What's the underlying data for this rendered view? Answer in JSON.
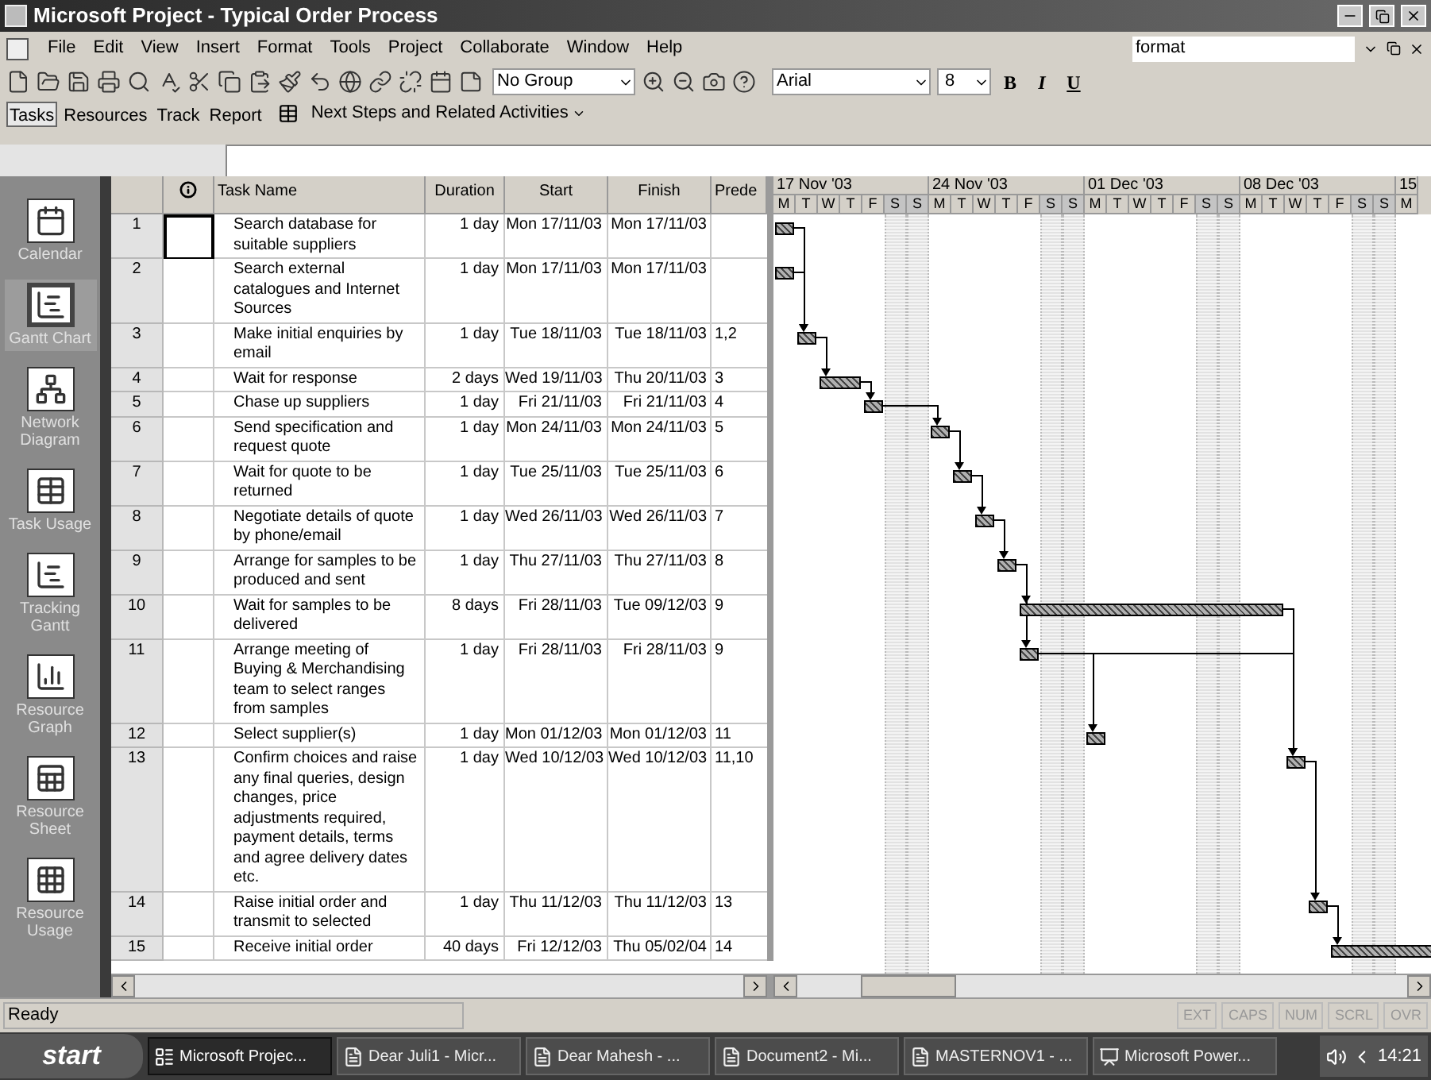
{
  "window": {
    "title": "Microsoft Project - Typical Order Process"
  },
  "menu": [
    "File",
    "Edit",
    "View",
    "Insert",
    "Format",
    "Tools",
    "Project",
    "Collaborate",
    "Window",
    "Help"
  ],
  "help_search": {
    "value": "format"
  },
  "toolbar": {
    "group": "No Group",
    "font": "Arial",
    "size": "8",
    "format_buttons": [
      "B",
      "I",
      "U"
    ]
  },
  "guide_toolbar": {
    "items": [
      {
        "label": "Tasks",
        "selected": true
      },
      {
        "label": "Resources",
        "selected": false
      },
      {
        "label": "Track",
        "selected": false
      },
      {
        "label": "Report",
        "selected": false
      }
    ],
    "next_steps": "Next Steps and Related Activities"
  },
  "view_bar": [
    {
      "label": "Calendar",
      "selected": false
    },
    {
      "label": "Gantt Chart",
      "selected": true
    },
    {
      "label": "Network Diagram",
      "selected": false
    },
    {
      "label": "Task Usage",
      "selected": false
    },
    {
      "label": "Tracking Gantt",
      "selected": false
    },
    {
      "label": "Resource Graph",
      "selected": false
    },
    {
      "label": "Resource Sheet",
      "selected": false
    },
    {
      "label": "Resource Usage",
      "selected": false
    }
  ],
  "table": {
    "columns": [
      "Task Name",
      "Duration",
      "Start",
      "Finish",
      "Prede"
    ],
    "rows": [
      {
        "id": "1",
        "name": "Search database for suitable suppliers",
        "duration": "1 day",
        "start": "Mon 17/11/03",
        "finish": "Mon 17/11/03",
        "selected": true
      },
      {
        "id": "2",
        "name": "Search external catalogues and Internet Sources",
        "duration": "1 day",
        "start": "Mon 17/11/03",
        "finish": "Mon 17/11/03",
        "selected": false
      },
      {
        "id": "3",
        "name": "Make initial enquiries by email",
        "duration": "1 day",
        "start": "Tue 18/11/03",
        "finish": "Tue 18/11/03",
        "predecessors": "1,2",
        "selected": false
      },
      {
        "id": "4",
        "name": "Wait for response",
        "duration": "2 days",
        "start": "Wed 19/11/03",
        "finish": "Thu 20/11/03",
        "predecessors": "3",
        "selected": false
      },
      {
        "id": "5",
        "name": "Chase up suppliers",
        "duration": "1 day",
        "start": "Fri 21/11/03",
        "finish": "Fri 21/11/03",
        "predecessors": "4",
        "selected": false
      },
      {
        "id": "6",
        "name": "Send specification and request quote",
        "duration": "1 day",
        "start": "Mon 24/11/03",
        "finish": "Mon 24/11/03",
        "predecessors": "5",
        "selected": false
      },
      {
        "id": "7",
        "name": "Wait for quote to be returned",
        "duration": "1 day",
        "start": "Tue 25/11/03",
        "finish": "Tue 25/11/03",
        "predecessors": "6",
        "selected": false
      },
      {
        "id": "8",
        "name": "Negotiate details of quote by phone/email",
        "duration": "1 day",
        "start": "Wed 26/11/03",
        "finish": "Wed 26/11/03",
        "predecessors": "7",
        "selected": false
      },
      {
        "id": "9",
        "name": "Arrange for samples to be produced and sent",
        "duration": "1 day",
        "start": "Thu 27/11/03",
        "finish": "Thu 27/11/03",
        "predecessors": "8",
        "selected": false
      },
      {
        "id": "10",
        "name": "Wait for samples to be delivered",
        "duration": "8 days",
        "start": "Fri 28/11/03",
        "finish": "Tue 09/12/03",
        "predecessors": "9",
        "selected": false
      },
      {
        "id": "11",
        "name": "Arrange meeting of Buying & Merchandising team to select ranges from samples",
        "duration": "1 day",
        "start": "Fri 28/11/03",
        "finish": "Fri 28/11/03",
        "predecessors": "9",
        "selected": false
      },
      {
        "id": "12",
        "name": "Select supplier(s)",
        "duration": "1 day",
        "start": "Mon 01/12/03",
        "finish": "Mon 01/12/03",
        "predecessors": "11",
        "selected": false
      },
      {
        "id": "13",
        "name": "Confirm choices and raise any final queries, design changes, price adjustments required, payment details, terms and agree delivery dates etc.",
        "duration": "1 day",
        "start": "Wed 10/12/03",
        "finish": "Wed 10/12/03",
        "predecessors": "11,10",
        "selected": false
      },
      {
        "id": "14",
        "name": "Raise initial order and transmit to selected",
        "duration": "1 day",
        "start": "Thu 11/12/03",
        "finish": "Thu 11/12/03",
        "predecessors": "13",
        "selected": false
      },
      {
        "id": "15",
        "name": "Receive initial order",
        "duration": "40 days",
        "start": "Fri 12/12/03",
        "finish": "Thu 05/02/04",
        "predecessors": "14",
        "selected": false
      }
    ]
  },
  "timeline": {
    "weeks": [
      {
        "label": "17 Nov '03",
        "days": [
          {
            "d": "M",
            "nonworking": false
          },
          {
            "d": "T",
            "nonworking": false
          },
          {
            "d": "W",
            "nonworking": false
          },
          {
            "d": "T",
            "nonworking": false
          },
          {
            "d": "F",
            "nonworking": false
          },
          {
            "d": "S",
            "nonworking": true
          },
          {
            "d": "S",
            "nonworking": true
          }
        ]
      },
      {
        "label": "24 Nov '03",
        "days": [
          {
            "d": "M",
            "nonworking": false
          },
          {
            "d": "T",
            "nonworking": false
          },
          {
            "d": "W",
            "nonworking": false
          },
          {
            "d": "T",
            "nonworking": false
          },
          {
            "d": "F",
            "nonworking": false
          },
          {
            "d": "S",
            "nonworking": true
          },
          {
            "d": "S",
            "nonworking": true
          }
        ]
      },
      {
        "label": "01 Dec '03",
        "days": [
          {
            "d": "M",
            "nonworking": false
          },
          {
            "d": "T",
            "nonworking": false
          },
          {
            "d": "W",
            "nonworking": false
          },
          {
            "d": "T",
            "nonworking": false
          },
          {
            "d": "F",
            "nonworking": false
          },
          {
            "d": "S",
            "nonworking": true
          },
          {
            "d": "S",
            "nonworking": true
          }
        ]
      },
      {
        "label": "08 Dec '03",
        "days": [
          {
            "d": "M",
            "nonworking": false
          },
          {
            "d": "T",
            "nonworking": false
          },
          {
            "d": "W",
            "nonworking": false
          },
          {
            "d": "T",
            "nonworking": false
          },
          {
            "d": "F",
            "nonworking": false
          },
          {
            "d": "S",
            "nonworking": true
          },
          {
            "d": "S",
            "nonworking": true
          }
        ]
      },
      {
        "label": "15",
        "days": [
          {
            "d": "M",
            "nonworking": false
          }
        ]
      }
    ]
  },
  "status_bar": {
    "text": "Ready",
    "indicators": [
      {
        "label": "EXT",
        "active": false
      },
      {
        "label": "CAPS",
        "active": false
      },
      {
        "label": "NUM",
        "active": false
      },
      {
        "label": "SCRL",
        "active": false
      },
      {
        "label": "OVR",
        "active": false
      }
    ]
  },
  "taskbar": {
    "start": "start",
    "buttons": [
      {
        "label": "Microsoft Projec...",
        "selected": true
      },
      {
        "label": "Dear Juli1 - Micr...",
        "selected": false
      },
      {
        "label": "Dear Mahesh - ...",
        "selected": false
      },
      {
        "label": "Document2 - Mi...",
        "selected": false
      },
      {
        "label": "MASTERNOV1 - ...",
        "selected": false
      },
      {
        "label": "Microsoft Power...",
        "selected": false
      }
    ],
    "clock": "14:21"
  }
}
